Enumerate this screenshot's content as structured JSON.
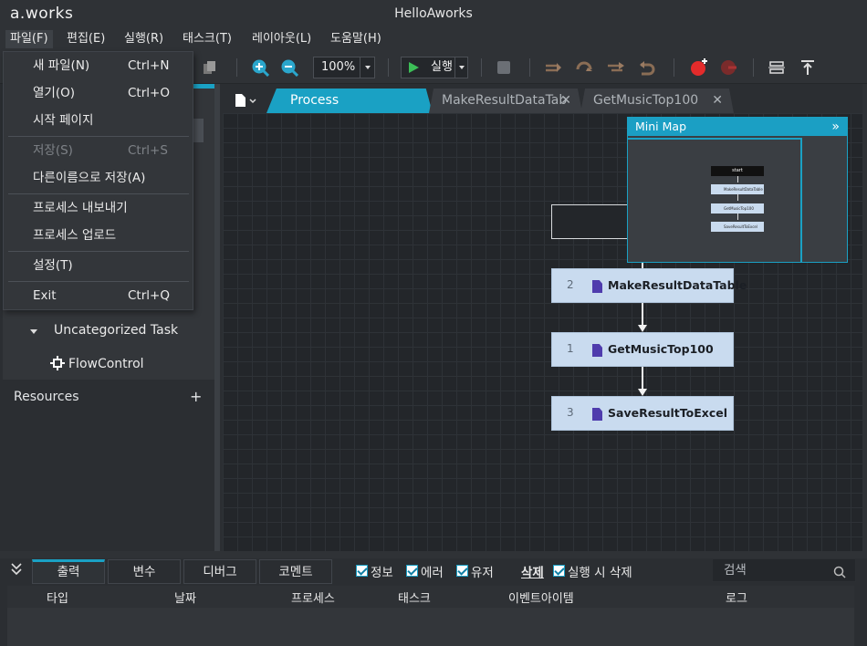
{
  "app": {
    "logo": "a.works",
    "window_title": "HelloAworks"
  },
  "menubar": [
    {
      "label": "파일(F)"
    },
    {
      "label": "편집(E)"
    },
    {
      "label": "실행(R)"
    },
    {
      "label": "태스크(T)"
    },
    {
      "label": "레이아웃(L)"
    },
    {
      "label": "도움말(H)"
    }
  ],
  "toolbar": {
    "zoom": "100%",
    "run_label": "실행"
  },
  "file_menu": [
    {
      "label": "새 파일(N)",
      "shortcut": "Ctrl+N"
    },
    {
      "label": "열기(O)",
      "shortcut": "Ctrl+O"
    },
    {
      "label": "시작 페이지",
      "shortcut": ""
    },
    {
      "label": "저장(S)",
      "shortcut": "Ctrl+S"
    },
    {
      "label": "다른이름으로 저장(A)",
      "shortcut": ""
    },
    {
      "label": "프로세스 내보내기",
      "shortcut": ""
    },
    {
      "label": "프로세스 업로드",
      "shortcut": ""
    },
    {
      "label": "설정(T)",
      "shortcut": ""
    },
    {
      "label": "Exit",
      "shortcut": "Ctrl+Q"
    }
  ],
  "left_panel": {
    "uncategorized": "Uncategorized Task",
    "flowcontrol": "FlowControl",
    "resources": "Resources",
    "add_symbol": "+"
  },
  "doc_tabs": [
    {
      "label": "Process"
    },
    {
      "label": "MakeResultDataTab"
    },
    {
      "label": "GetMusicTop100"
    }
  ],
  "nodes": [
    {
      "num": "2",
      "label": "MakeResultDataTable"
    },
    {
      "num": "1",
      "label": "GetMusicTop100"
    },
    {
      "num": "3",
      "label": "SaveResultToExcel"
    }
  ],
  "minimap": {
    "title": "Mini Map",
    "start": "start",
    "nodes": [
      "MakeResultDataTable",
      "GetMusicTop100",
      "SaveResultToExcel"
    ]
  },
  "bottom": {
    "tabs": [
      "출력",
      "변수",
      "디버그",
      "코멘트"
    ],
    "filters": [
      "정보",
      "에러",
      "유저"
    ],
    "delete_label": "삭제",
    "delete_on_run": "실행 시 삭제",
    "search_placeholder": "검색",
    "columns": [
      "타입",
      "날짜",
      "프로세스",
      "태스크",
      "이벤트아이템",
      "로그"
    ]
  },
  "colors": {
    "accent": "#1aa1c4",
    "node_fill": "#c9dbef",
    "run_green": "#3cbe57"
  }
}
